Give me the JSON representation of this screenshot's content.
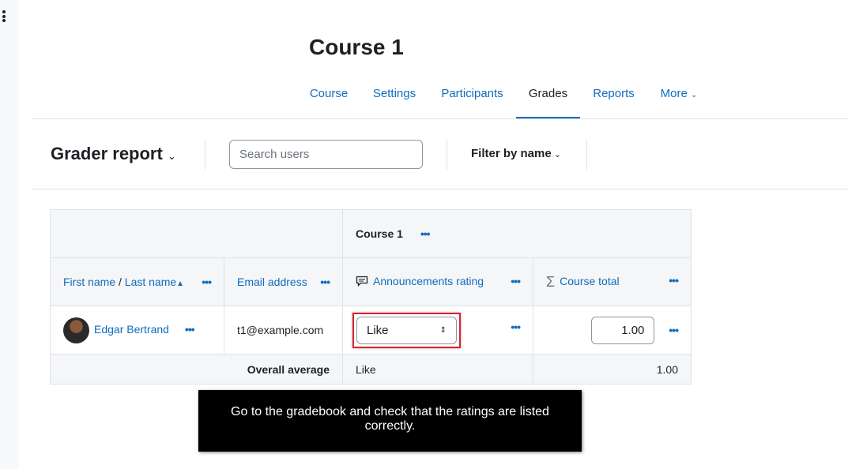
{
  "course": {
    "title": "Course 1"
  },
  "nav": [
    {
      "label": "Course"
    },
    {
      "label": "Settings"
    },
    {
      "label": "Participants"
    },
    {
      "label": "Grades"
    },
    {
      "label": "Reports"
    },
    {
      "label": "More"
    }
  ],
  "report": {
    "title": "Grader report",
    "search_placeholder": "Search users",
    "filter_label": "Filter by name"
  },
  "table": {
    "category_header": "Course 1",
    "columns": {
      "first_name": "First name",
      "name_sep": "/",
      "last_name": "Last name",
      "email": "Email address",
      "rating": "Announcements rating",
      "total": "Course total"
    },
    "rows": [
      {
        "name": "Edgar Bertrand",
        "email": "t1@example.com",
        "rating": "Like",
        "total": "1.00"
      }
    ],
    "average": {
      "label": "Overall average",
      "rating": "Like",
      "total": "1.00"
    }
  },
  "tooltip": {
    "text": "Go to the gradebook and check that the ratings are listed correctly."
  },
  "colors": {
    "link": "#0f6cbf",
    "highlight": "#d9232d",
    "text": "#1d2125"
  }
}
